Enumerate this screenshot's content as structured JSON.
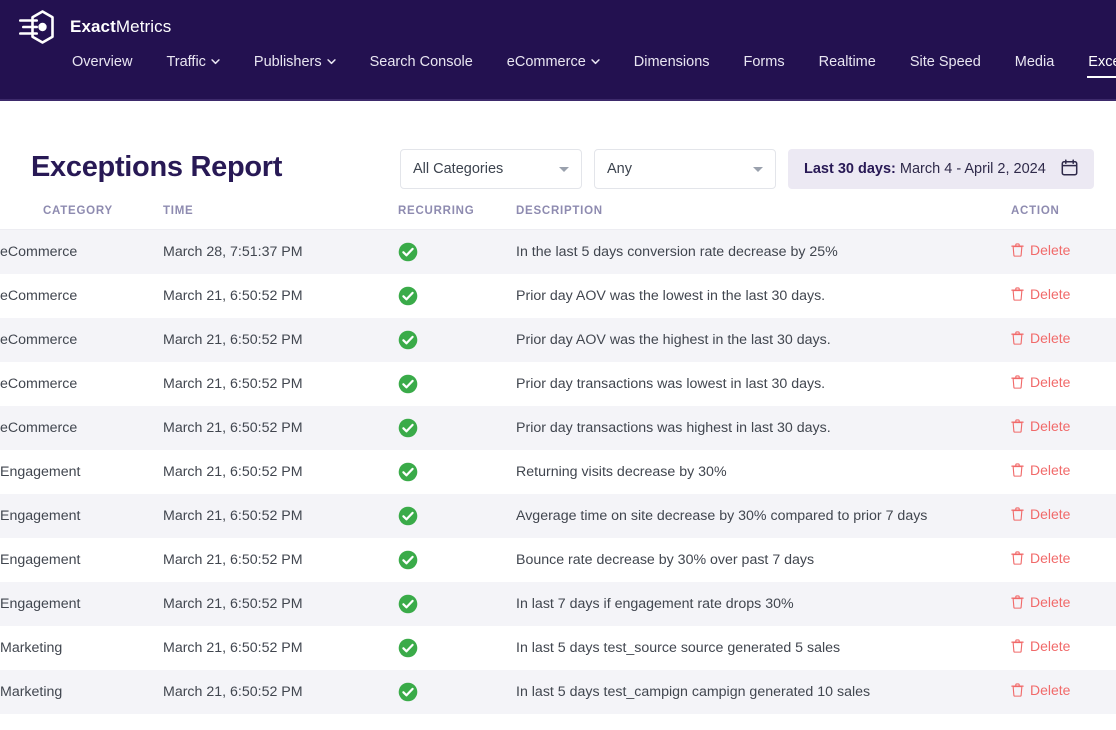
{
  "brand": {
    "name_bold": "Exact",
    "name_light": "Metrics",
    "logo_icon": "exactmetrics-hex-logo-icon"
  },
  "nav": {
    "items": [
      {
        "label": "Overview",
        "has_caret": false,
        "active": false
      },
      {
        "label": "Traffic",
        "has_caret": true,
        "active": false
      },
      {
        "label": "Publishers",
        "has_caret": true,
        "active": false
      },
      {
        "label": "Search Console",
        "has_caret": false,
        "active": false
      },
      {
        "label": "eCommerce",
        "has_caret": true,
        "active": false
      },
      {
        "label": "Dimensions",
        "has_caret": false,
        "active": false
      },
      {
        "label": "Forms",
        "has_caret": false,
        "active": false
      },
      {
        "label": "Realtime",
        "has_caret": false,
        "active": false
      },
      {
        "label": "Site Speed",
        "has_caret": false,
        "active": false
      },
      {
        "label": "Media",
        "has_caret": false,
        "active": false
      },
      {
        "label": "Exceptions",
        "has_caret": false,
        "active": true
      }
    ]
  },
  "report": {
    "title": "Exceptions Report",
    "category_filter": {
      "value": "All Categories",
      "icon": "chevron-down-icon"
    },
    "recurring_filter": {
      "value": "Any",
      "icon": "chevron-down-icon"
    },
    "date_range": {
      "prefix": "Last 30 days:",
      "range": " March 4 - April 2, 2024",
      "icon": "calendar-icon"
    }
  },
  "table": {
    "columns": [
      "CATEGORY",
      "TIME",
      "RECURRING",
      "DESCRIPTION",
      "ACTION"
    ],
    "action_label": "Delete",
    "action_icon": "trash-icon",
    "recurring_icon": "check-circle-icon",
    "rows": [
      {
        "category": "eCommerce",
        "time": "March 28, 7:51:37 PM",
        "recurring": true,
        "description": "In the last 5 days conversion rate decrease by 25%"
      },
      {
        "category": "eCommerce",
        "time": "March 21, 6:50:52 PM",
        "recurring": true,
        "description": "Prior day AOV was the lowest in the last 30 days."
      },
      {
        "category": "eCommerce",
        "time": "March 21, 6:50:52 PM",
        "recurring": true,
        "description": "Prior day AOV was the highest in the last 30 days."
      },
      {
        "category": "eCommerce",
        "time": "March 21, 6:50:52 PM",
        "recurring": true,
        "description": "Prior day transactions was lowest in last 30 days."
      },
      {
        "category": "eCommerce",
        "time": "March 21, 6:50:52 PM",
        "recurring": true,
        "description": "Prior day transactions was highest in last 30 days."
      },
      {
        "category": "Engagement",
        "time": "March 21, 6:50:52 PM",
        "recurring": true,
        "description": "Returning visits decrease by 30%"
      },
      {
        "category": "Engagement",
        "time": "March 21, 6:50:52 PM",
        "recurring": true,
        "description": "Avgerage time on site decrease by 30% compared to prior 7 days"
      },
      {
        "category": "Engagement",
        "time": "March 21, 6:50:52 PM",
        "recurring": true,
        "description": "Bounce rate decrease by 30% over past 7 days"
      },
      {
        "category": "Engagement",
        "time": "March 21, 6:50:52 PM",
        "recurring": true,
        "description": "In last 7 days if engagement rate drops 30%"
      },
      {
        "category": "Marketing",
        "time": "March 21, 6:50:52 PM",
        "recurring": true,
        "description": "In last 5 days test_source source generated 5 sales"
      },
      {
        "category": "Marketing",
        "time": "March 21, 6:50:52 PM",
        "recurring": true,
        "description": "In last 5 days test_campign campign generated 10 sales"
      }
    ]
  },
  "colors": {
    "nav_bg": "#231150",
    "title": "#281955",
    "date_chip_bg": "#ece9f3",
    "row_stripe": "#f4f4f8",
    "check_green": "#3aab49",
    "delete_red": "#f16a6a",
    "column_header": "#8e8bb0"
  }
}
